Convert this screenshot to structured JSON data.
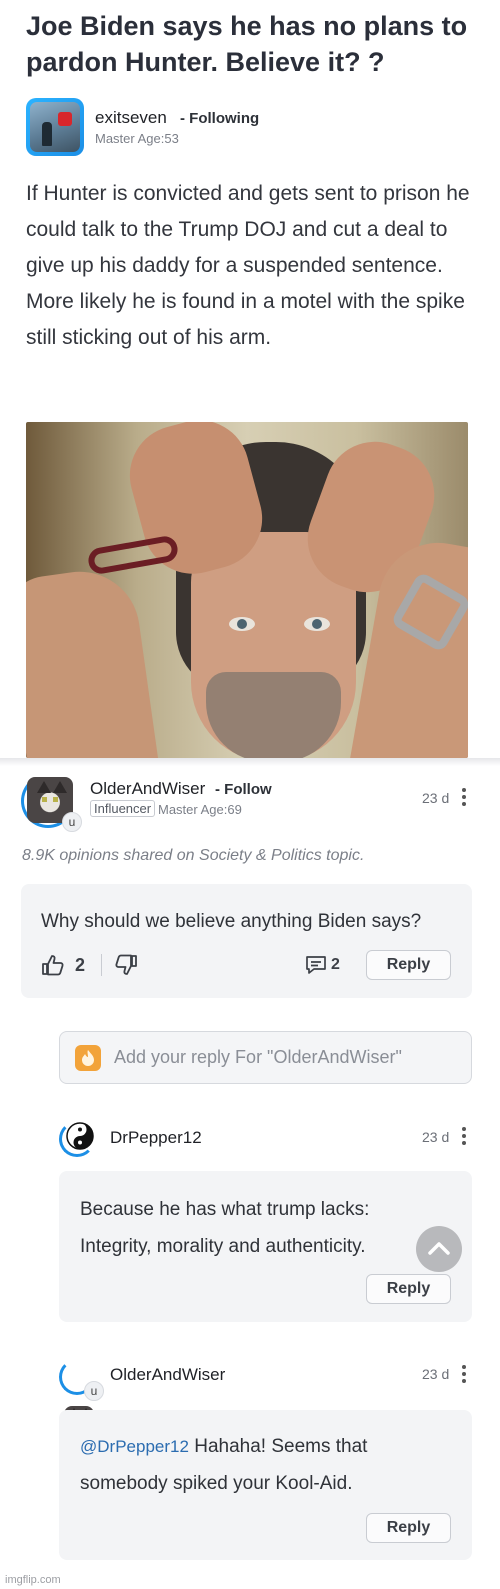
{
  "question": {
    "title": "Joe Biden says he has no plans to pardon Hunter. Believe it? ?",
    "author": "exitseven",
    "follow_status": "- Following",
    "meta": "Master Age:53",
    "body": "If Hunter is convicted and gets sent to prison he could talk to the Trump DOJ and cut a deal to give up his daddy for a suspended sentence. More likely he is found in a motel with the spike still sticking out of his arm."
  },
  "top_answer": {
    "author": "OlderAndWiser",
    "follow_label": "- Follow",
    "badge_letter": "u",
    "role": "Influencer",
    "meta": "Master Age:69",
    "age": "23 d",
    "opinions_note": "8.9K opinions shared on Society & Politics topic.",
    "text": "Why should we believe anything Biden says?",
    "likes": "2",
    "comments": "2",
    "reply_label": "Reply"
  },
  "reply_input": {
    "placeholder": "Add your reply For \"OlderAndWiser\""
  },
  "replies": [
    {
      "author": "DrPepper12",
      "age": "23 d",
      "line1": "Because he has what trump lacks:",
      "line2": "Integrity, morality and authenticity.",
      "reply_label": "Reply"
    },
    {
      "author": "OlderAndWiser",
      "badge_letter": "u",
      "age": "23 d",
      "mention": "@DrPepper12",
      "line1": " Hahaha! Seems that",
      "line2": "somebody spiked your Kool-Aid.",
      "reply_label": "Reply"
    }
  ],
  "watermark": "imgflip.com",
  "colors": {
    "accent": "#1c8fe6",
    "card_bg": "#f3f4f6",
    "mention": "#2b6cb0"
  },
  "icons": [
    "stop-sign-avatar",
    "thumbs-up-icon",
    "thumbs-down-icon",
    "comment-icon",
    "more-vert-icon",
    "fire-badge-icon",
    "yin-yang-icon",
    "chevron-up-icon"
  ]
}
